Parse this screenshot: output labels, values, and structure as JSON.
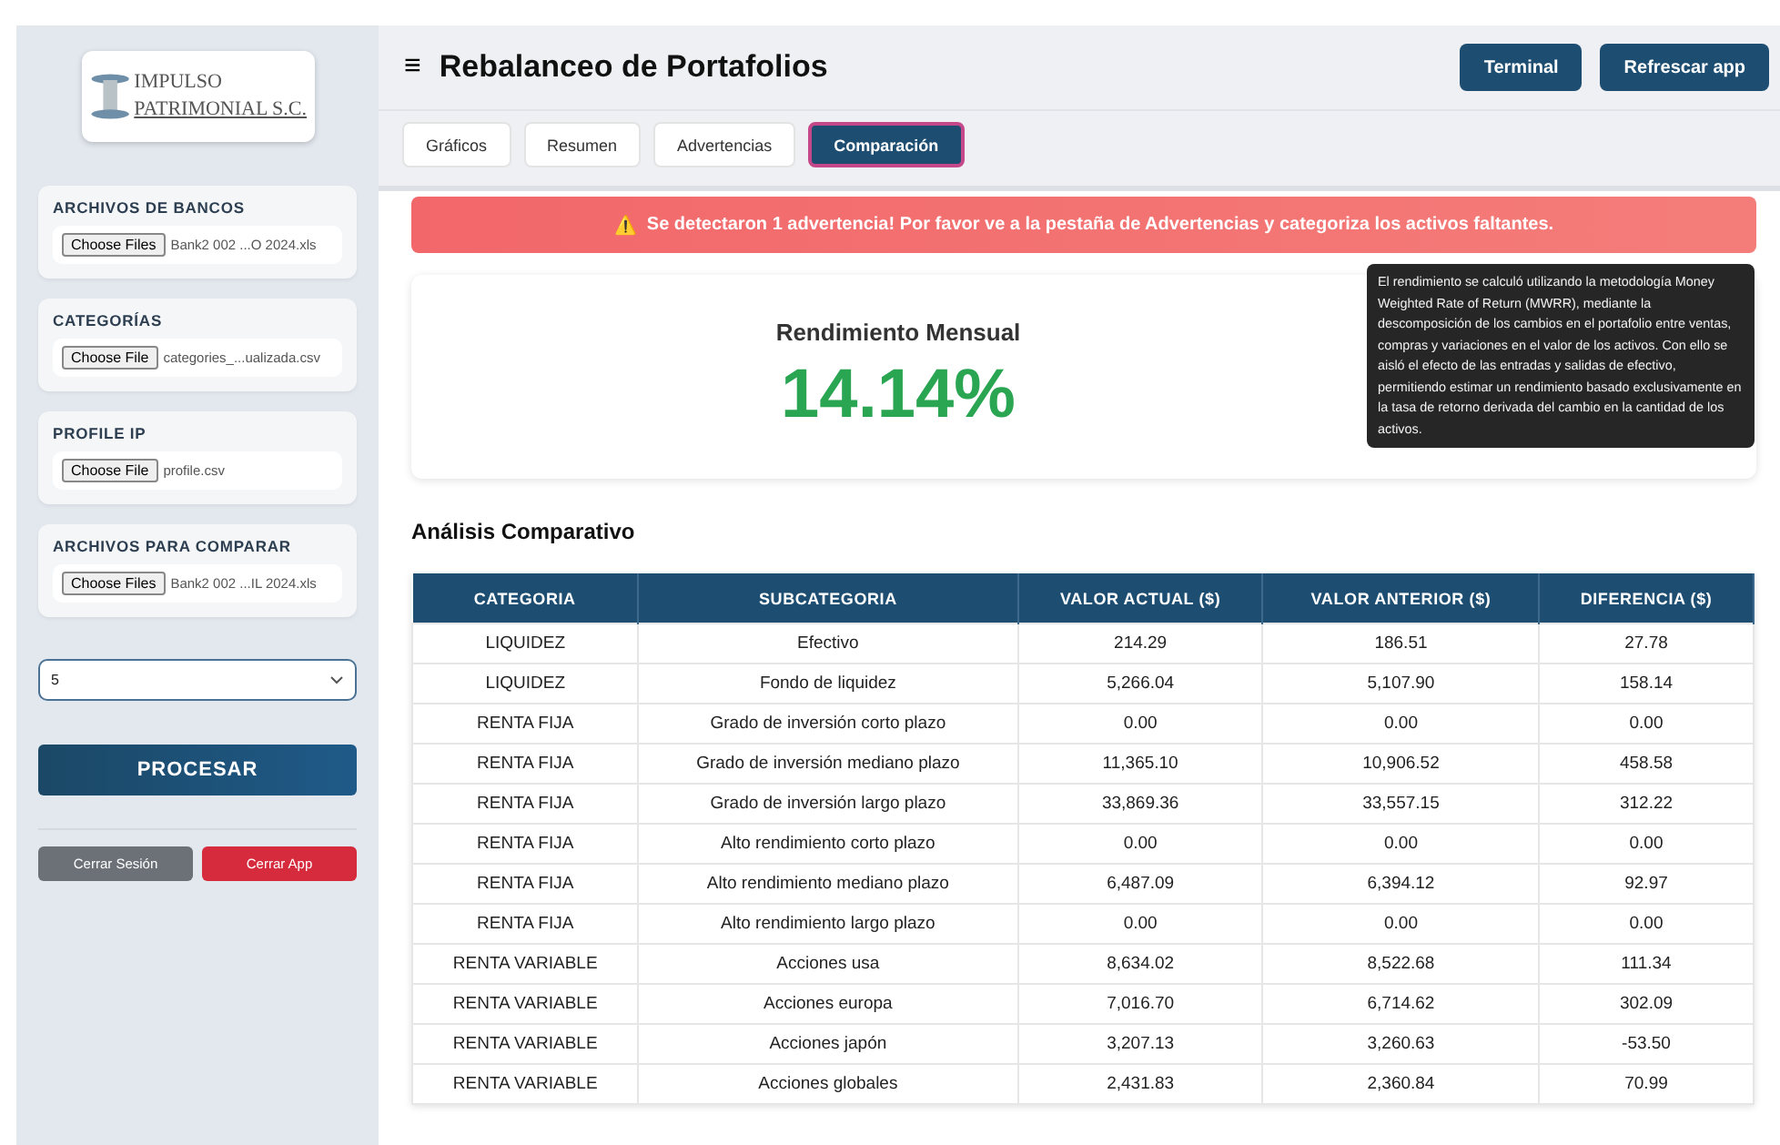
{
  "logo": {
    "line_1": "IMPULSO",
    "line_2": "PATRIMONIAL S.C."
  },
  "sidebar": {
    "uploads": [
      {
        "label": "ARCHIVOS DE BANCOS",
        "button": "Choose Files",
        "file": "Bank2 002 ...O 2024.xls"
      },
      {
        "label": "CATEGORÍAS",
        "button": "Choose File",
        "file": "categories_...ualizada.csv"
      },
      {
        "label": "PROFILE IP",
        "button": "Choose File",
        "file": "profile.csv"
      },
      {
        "label": "ARCHIVOS PARA COMPARAR",
        "button": "Choose Files",
        "file": "Bank2 002 ...IL 2024.xls"
      }
    ],
    "select": {
      "value": "5"
    },
    "process_button": "PROCESAR",
    "footer_buttons": [
      {
        "label": "Cerrar Sesión",
        "kind": "secondary"
      },
      {
        "label": "Cerrar App",
        "kind": "danger"
      }
    ]
  },
  "header": {
    "menu_icon": "≡",
    "title": "Rebalanceo de Portafolios",
    "buttons": [
      "Terminal",
      "Refrescar app"
    ]
  },
  "tabs": [
    {
      "label": "Gráficos",
      "selected": false
    },
    {
      "label": "Resumen",
      "selected": false
    },
    {
      "label": "Advertencias",
      "selected": false
    },
    {
      "label": "Comparación",
      "selected": true
    }
  ],
  "alert": {
    "icon": "⚠️",
    "text": "Se detectaron 1 advertencia! Por favor ve a la pestaña de Advertencias y categoriza los activos faltantes."
  },
  "metric": {
    "title": "Rendimiento Mensual",
    "value": "14.14%"
  },
  "tooltip": "El rendimiento se calculó utilizando la metodología Money Weighted Rate of Return (MWRR), mediante la descomposición de los cambios en el portafolio entre ventas, compras y variaciones en el valor de los activos. Con ello se aisló el efecto de las entradas y salidas de efectivo, permitiendo estimar un rendimiento basado exclusivamente en la tasa de retorno derivada del cambio en la cantidad de los activos.",
  "section_title": "Análisis Comparativo",
  "table": {
    "columns": [
      "CATEGORIA",
      "SUBCATEGORIA",
      "VALOR ACTUAL ($)",
      "VALOR ANTERIOR ($)",
      "DIFERENCIA ($)"
    ],
    "rows": [
      [
        "LIQUIDEZ",
        "Efectivo",
        "214.29",
        "186.51",
        "27.78"
      ],
      [
        "LIQUIDEZ",
        "Fondo de liquidez",
        "5,266.04",
        "5,107.90",
        "158.14"
      ],
      [
        "RENTA FIJA",
        "Grado de inversión corto plazo",
        "0.00",
        "0.00",
        "0.00"
      ],
      [
        "RENTA FIJA",
        "Grado de inversión mediano plazo",
        "11,365.10",
        "10,906.52",
        "458.58"
      ],
      [
        "RENTA FIJA",
        "Grado de inversión largo plazo",
        "33,869.36",
        "33,557.15",
        "312.22"
      ],
      [
        "RENTA FIJA",
        "Alto rendimiento corto plazo",
        "0.00",
        "0.00",
        "0.00"
      ],
      [
        "RENTA FIJA",
        "Alto rendimiento mediano plazo",
        "6,487.09",
        "6,394.12",
        "92.97"
      ],
      [
        "RENTA FIJA",
        "Alto rendimiento largo plazo",
        "0.00",
        "0.00",
        "0.00"
      ],
      [
        "RENTA VARIABLE",
        "Acciones usa",
        "8,634.02",
        "8,522.68",
        "111.34"
      ],
      [
        "RENTA VARIABLE",
        "Acciones europa",
        "7,016.70",
        "6,714.62",
        "302.09"
      ],
      [
        "RENTA VARIABLE",
        "Acciones japón",
        "3,207.13",
        "3,260.63",
        "-53.50"
      ],
      [
        "RENTA VARIABLE",
        "Acciones globales",
        "2,431.83",
        "2,360.84",
        "70.99"
      ]
    ]
  }
}
